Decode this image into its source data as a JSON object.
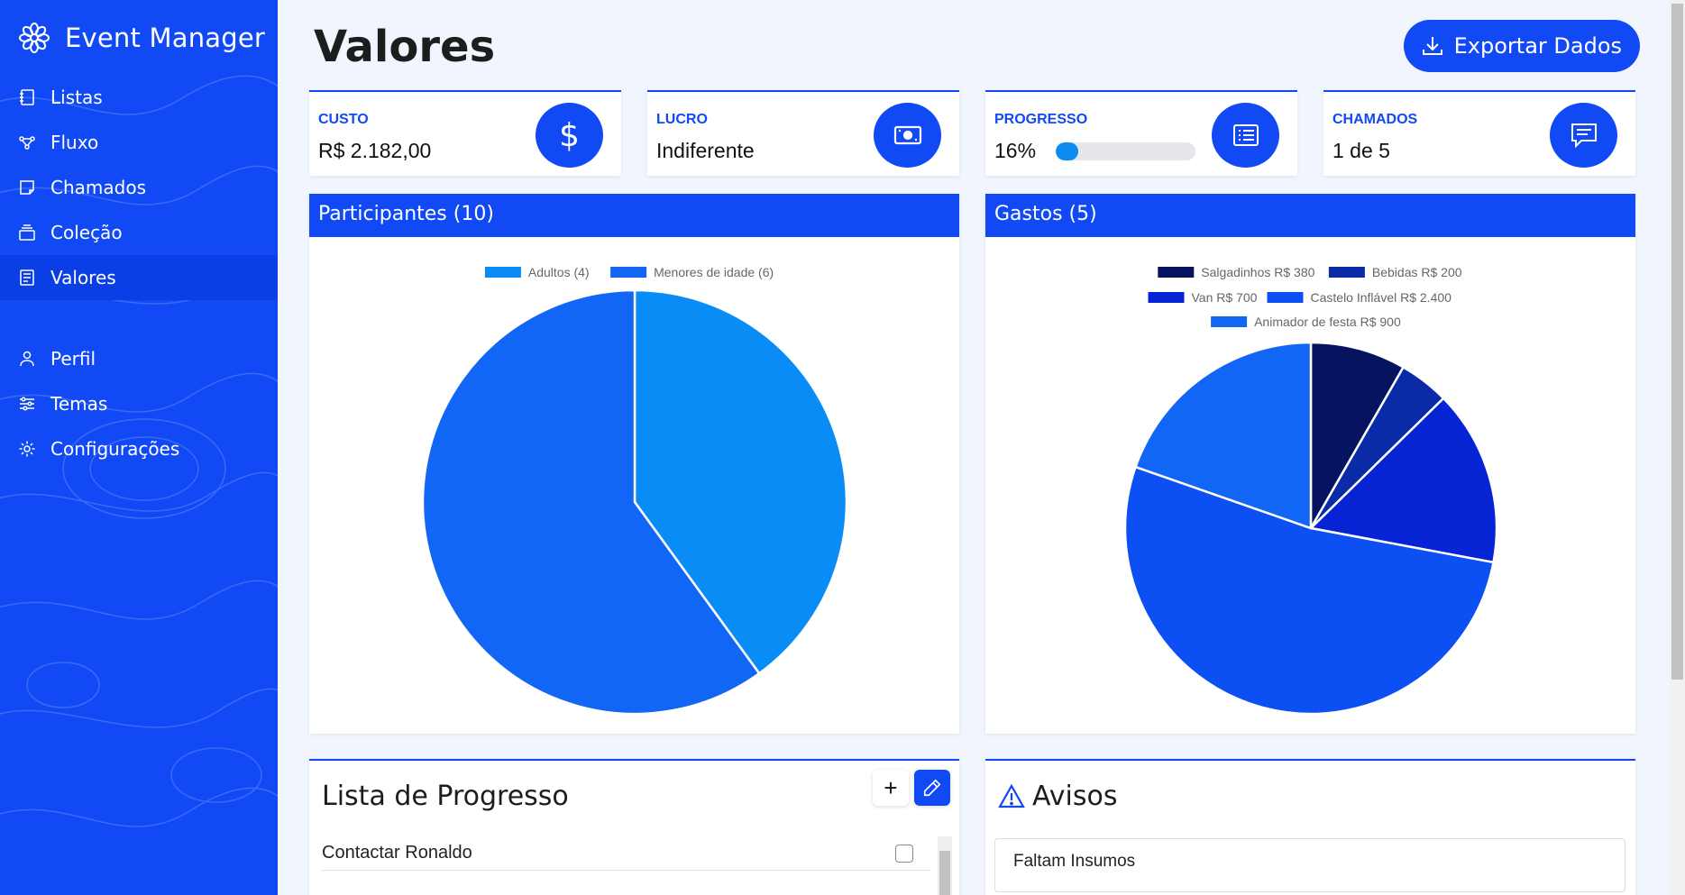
{
  "sidebar": {
    "brand": "Event Manager",
    "items": [
      {
        "label": "Listas",
        "icon": "notebook-icon"
      },
      {
        "label": "Fluxo",
        "icon": "flow-icon"
      },
      {
        "label": "Chamados",
        "icon": "ticket-icon"
      },
      {
        "label": "Coleção",
        "icon": "collection-icon"
      },
      {
        "label": "Valores",
        "icon": "receipt-icon",
        "active": true
      }
    ],
    "secondary": [
      {
        "label": "Perfil",
        "icon": "user-icon"
      },
      {
        "label": "Temas",
        "icon": "sliders-icon"
      },
      {
        "label": "Configurações",
        "icon": "gear-icon"
      }
    ]
  },
  "header": {
    "title": "Valores",
    "export_label": "Exportar Dados"
  },
  "stats": {
    "custo": {
      "label": "CUSTO",
      "value": "R$ 2.182,00"
    },
    "lucro": {
      "label": "LUCRO",
      "value": "Indiferente"
    },
    "progresso": {
      "label": "PROGRESSO",
      "value": "16%",
      "percent": 16
    },
    "chamados": {
      "label": "CHAMADOS",
      "value": "1 de 5"
    }
  },
  "participants_card": {
    "title": "Participantes (10)"
  },
  "expenses_card": {
    "title": "Gastos (5)"
  },
  "chart_data": [
    {
      "type": "pie",
      "title": "",
      "categories": [
        "Adultos (4)",
        "Menores de idade (6)"
      ],
      "values": [
        4,
        6
      ],
      "colors": [
        "#0a8cf7",
        "#1266f5"
      ],
      "legend": "top"
    },
    {
      "type": "pie",
      "title": "",
      "categories": [
        "Salgadinhos R$ 380",
        "Bebidas R$ 200",
        "Van R$ 700",
        "Castelo Inflável R$ 2.400",
        "Animador de festa R$ 900"
      ],
      "values": [
        380,
        200,
        700,
        2400,
        900
      ],
      "colors": [
        "#06145f",
        "#0a2aa8",
        "#0624d4",
        "#0c4ff2",
        "#1266f5"
      ],
      "legend": "top"
    }
  ],
  "progress_list": {
    "title": "Lista de Progresso",
    "add_label": "+",
    "items": [
      {
        "label": "Contactar Ronaldo",
        "checked": false
      }
    ]
  },
  "notices": {
    "title": "Avisos",
    "items": [
      "Faltam Insumos"
    ]
  }
}
